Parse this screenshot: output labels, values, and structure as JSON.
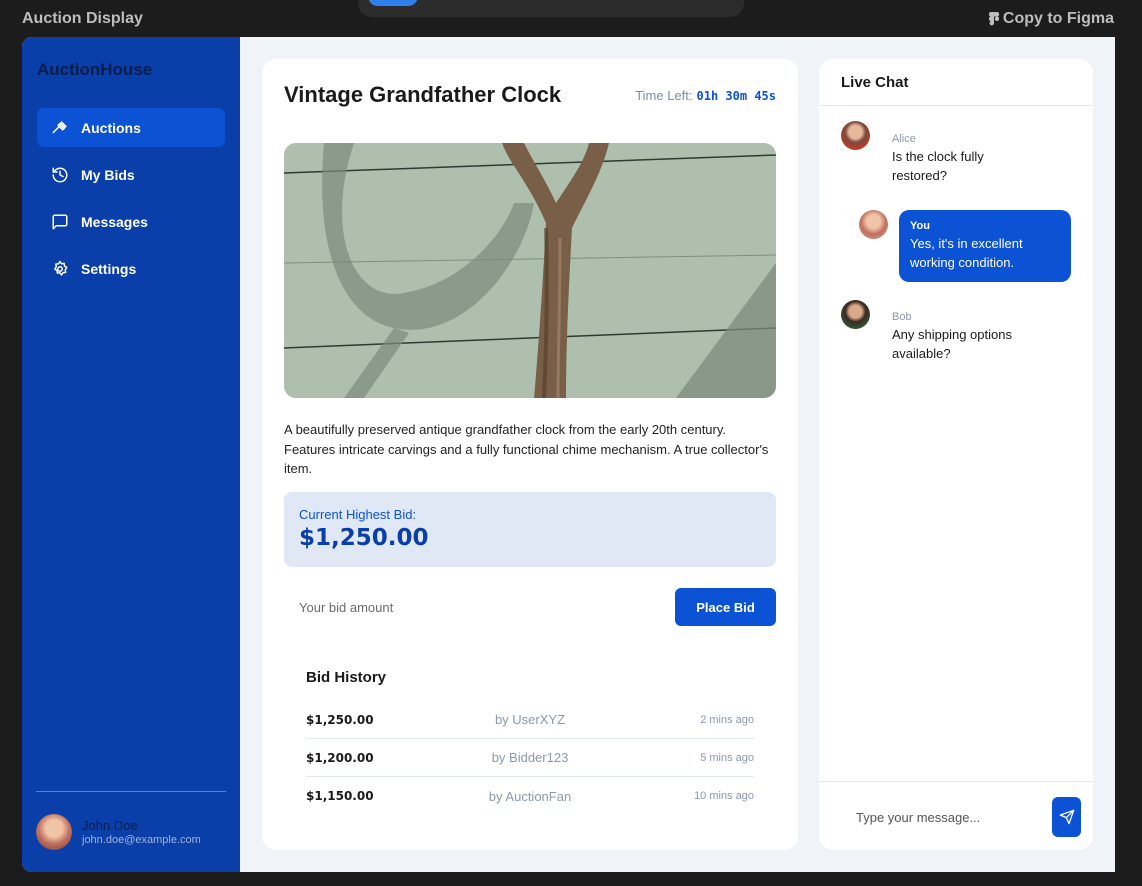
{
  "window": {
    "title": "Auction Display",
    "figma_label": "Copy to Figma"
  },
  "sidebar": {
    "brand": "AuctionHouse",
    "items": [
      {
        "label": "Auctions",
        "icon": "gavel-icon",
        "active": true
      },
      {
        "label": "My Bids",
        "icon": "history-icon",
        "active": false
      },
      {
        "label": "Messages",
        "icon": "message-icon",
        "active": false
      },
      {
        "label": "Settings",
        "icon": "gear-icon",
        "active": false
      }
    ],
    "user": {
      "name": "John Doe",
      "email": "john.doe@example.com"
    }
  },
  "item": {
    "title": "Vintage Grandfather Clock",
    "time_left_label": "Time Left:",
    "time_left_value": "01h 30m 45s",
    "description": "A beautifully preserved antique grandfather clock from the early 20th century. Features intricate carvings and a fully functional chime mechanism. A true collector's item.",
    "current_bid_label": "Current Highest Bid:",
    "current_bid_value": "$1,250.00",
    "bid_placeholder": "Your bid amount",
    "place_bid_label": "Place Bid"
  },
  "history": {
    "title": "Bid History",
    "rows": [
      {
        "amount": "$1,250.00",
        "user": "by UserXYZ",
        "time": "2 mins ago"
      },
      {
        "amount": "$1,200.00",
        "user": "by Bidder123",
        "time": "5 mins ago"
      },
      {
        "amount": "$1,150.00",
        "user": "by AuctionFan",
        "time": "10 mins ago"
      }
    ]
  },
  "chat": {
    "title": "Live Chat",
    "messages": [
      {
        "name": "Alice",
        "text": "Is the clock fully restored?"
      },
      {
        "name": "You",
        "text": "Yes, it's in excellent working condition."
      },
      {
        "name": "Bob",
        "text": "Any shipping options available?"
      }
    ],
    "input_placeholder": "Type your message...",
    "accent": "#0b52d4"
  }
}
